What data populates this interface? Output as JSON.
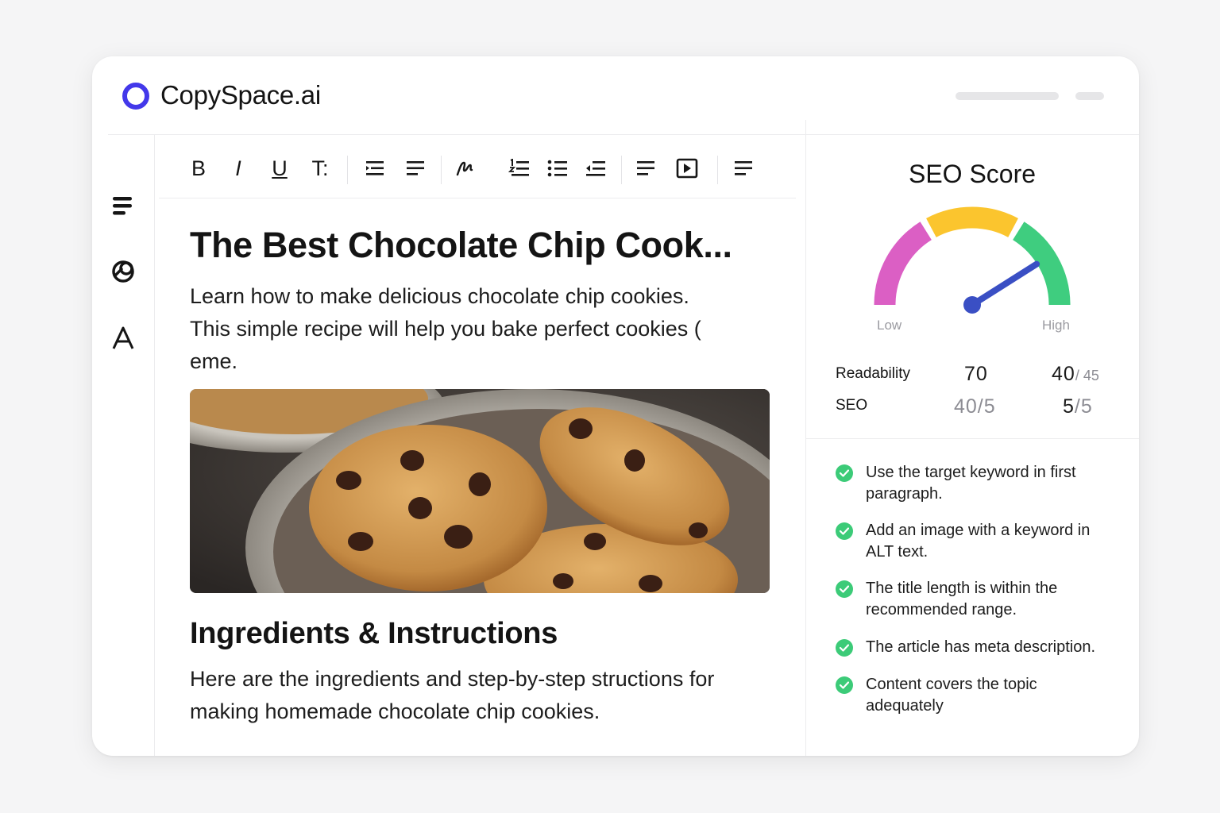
{
  "app": {
    "brand": "CopySpace.ai"
  },
  "sidebar": {
    "items": [
      {
        "icon": "menu-icon"
      },
      {
        "icon": "overlap-circles-icon"
      },
      {
        "icon": "font-icon"
      }
    ]
  },
  "toolbar": {
    "bold_label": "B",
    "italic_label": "I",
    "underline_label": "U",
    "text_size_label": "T:",
    "icons": [
      "indent-icon",
      "align-left-icon",
      "signature-icon",
      "ordered-list-icon",
      "bullet-list-icon",
      "outdent-icon",
      "paragraph-icon",
      "media-play-icon",
      "more-lines-icon"
    ]
  },
  "editor": {
    "title": "The Best Chocolate Chip Cook...",
    "intro_line1": "Learn how to make delicious chocolate chip cookies.",
    "intro_line2": "This simple recipe will help you bake perfect cookies (",
    "intro_line3": "eme.",
    "image_alt": "cookies-image",
    "section_heading": "Ingredients & Instructions",
    "section_body_line1": "Here are the ingredients and step-by-step structions for",
    "section_body_line2": "making homemade chocolate chip cookies."
  },
  "seo_panel": {
    "title": "SEO Score",
    "gauge": {
      "low_label": "Low",
      "high_label": "High",
      "needle_fraction": 0.82,
      "colors": {
        "low": "#db5fc4",
        "mid": "#fbc52e",
        "high": "#3fcd7f",
        "needle": "#3a4fc4"
      }
    },
    "metrics": {
      "readability_label": "Readability",
      "readability_value": "70",
      "readability_score_main": "40",
      "readability_score_total": "/ 45",
      "seo_label": "SEO",
      "seo_value": "40/5",
      "seo_score_main": "5",
      "seo_score_total": "/5"
    },
    "checklist": [
      {
        "text_line1": "Use the target keyword in first",
        "text_line2": "paragraph."
      },
      {
        "text_line1": "Add an image with a keyword in",
        "text_line2": "ALT text."
      },
      {
        "text_line1": "The title length is within the",
        "text_line2": "recommended range."
      },
      {
        "text_line1": "The article has meta description.",
        "text_line2": ""
      },
      {
        "text_line1": "Content covers the topic",
        "text_line2": "adequately"
      }
    ]
  }
}
